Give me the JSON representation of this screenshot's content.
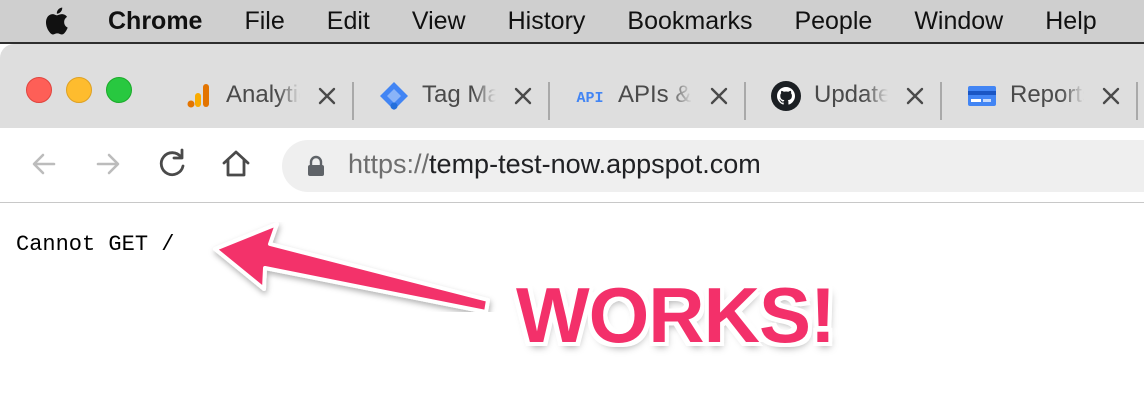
{
  "menubar": {
    "apple_icon": "apple-icon",
    "items": [
      "Chrome",
      "File",
      "Edit",
      "View",
      "History",
      "Bookmarks",
      "People",
      "Window",
      "Help"
    ]
  },
  "tabs": [
    {
      "title": "Analytics",
      "icon": "google-analytics-icon"
    },
    {
      "title": "Tag Manager",
      "icon": "tag-manager-icon"
    },
    {
      "title": "APIs & Services",
      "icon": "api-icon"
    },
    {
      "title": "Update",
      "icon": "github-icon"
    },
    {
      "title": "Reports",
      "icon": "card-icon"
    }
  ],
  "toolbar": {
    "url_scheme": "https://",
    "url_host": "temp-test-now.appspot.com"
  },
  "page": {
    "body_text": "Cannot GET /"
  },
  "annotation": {
    "text": "WORKS!",
    "color": "#f3306a"
  },
  "colors": {
    "traffic_red": "#fe5f57",
    "traffic_yellow": "#febc2e",
    "traffic_green": "#28c840",
    "tabstrip": "#dedede"
  }
}
